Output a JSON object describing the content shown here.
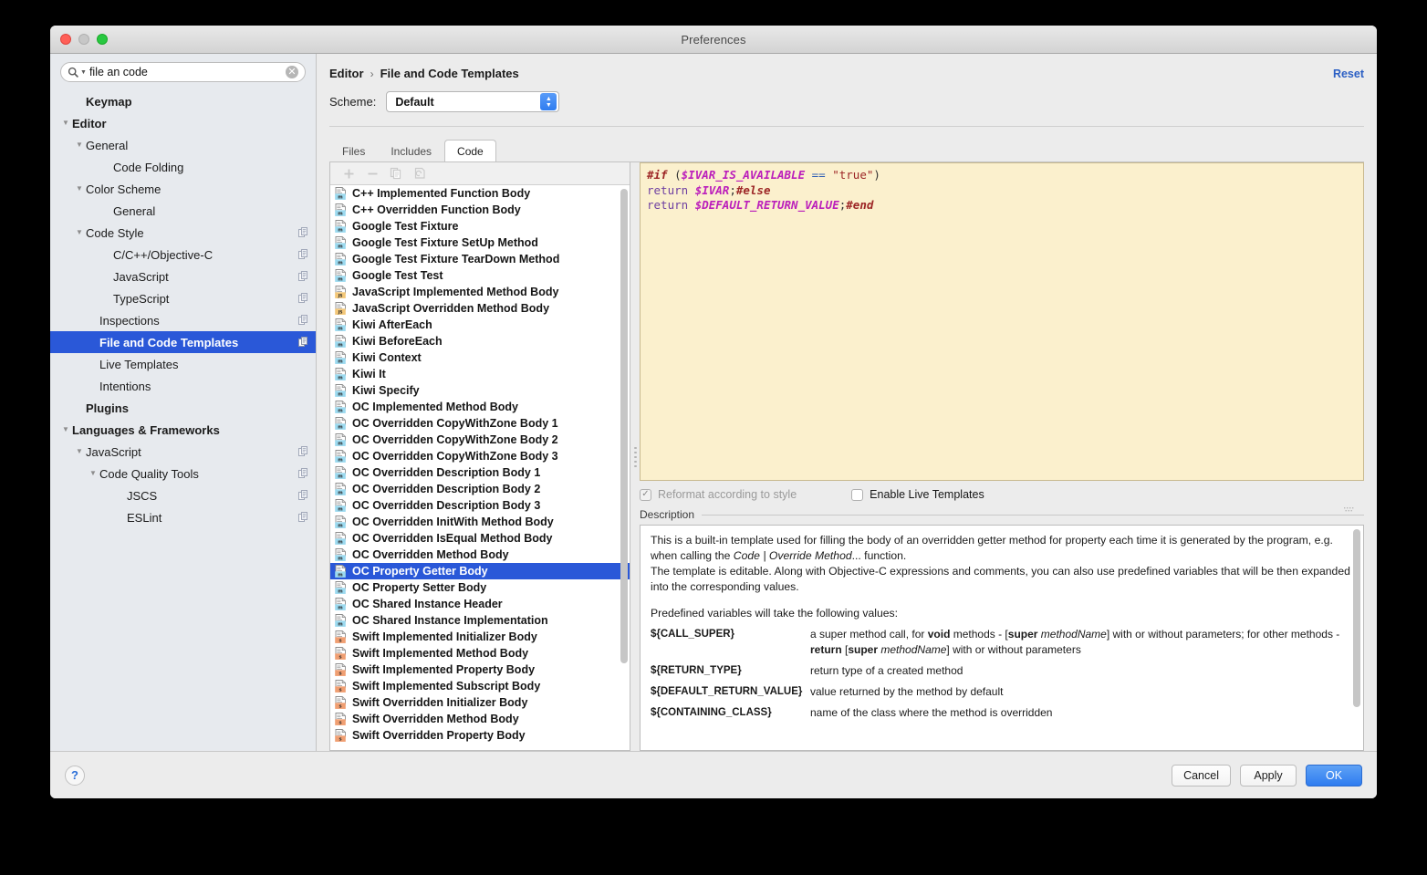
{
  "window": {
    "title": "Preferences"
  },
  "search": {
    "value": "file an code",
    "placeholder": "",
    "clear_glyph": "✕"
  },
  "sidebar": {
    "items": [
      {
        "label": "Keymap",
        "indent": 1,
        "bold": true,
        "twisty": "",
        "badge": false,
        "selected": false
      },
      {
        "label": "Editor",
        "indent": 0,
        "bold": true,
        "twisty": "▼",
        "badge": false,
        "selected": false
      },
      {
        "label": "General",
        "indent": 1,
        "bold": false,
        "twisty": "▼",
        "badge": false,
        "selected": false
      },
      {
        "label": "Code Folding",
        "indent": 3,
        "bold": false,
        "twisty": "",
        "badge": false,
        "selected": false
      },
      {
        "label": "Color Scheme",
        "indent": 1,
        "bold": false,
        "twisty": "▼",
        "badge": false,
        "selected": false
      },
      {
        "label": "General",
        "indent": 3,
        "bold": false,
        "twisty": "",
        "badge": false,
        "selected": false
      },
      {
        "label": "Code Style",
        "indent": 1,
        "bold": false,
        "twisty": "▼",
        "badge": true,
        "selected": false
      },
      {
        "label": "C/C++/Objective-C",
        "indent": 3,
        "bold": false,
        "twisty": "",
        "badge": true,
        "selected": false
      },
      {
        "label": "JavaScript",
        "indent": 3,
        "bold": false,
        "twisty": "",
        "badge": true,
        "selected": false
      },
      {
        "label": "TypeScript",
        "indent": 3,
        "bold": false,
        "twisty": "",
        "badge": true,
        "selected": false
      },
      {
        "label": "Inspections",
        "indent": 2,
        "bold": false,
        "twisty": "",
        "badge": true,
        "selected": false
      },
      {
        "label": "File and Code Templates",
        "indent": 2,
        "bold": true,
        "twisty": "",
        "badge": true,
        "selected": true
      },
      {
        "label": "Live Templates",
        "indent": 2,
        "bold": false,
        "twisty": "",
        "badge": false,
        "selected": false
      },
      {
        "label": "Intentions",
        "indent": 2,
        "bold": false,
        "twisty": "",
        "badge": false,
        "selected": false
      },
      {
        "label": "Plugins",
        "indent": 1,
        "bold": true,
        "twisty": "",
        "badge": false,
        "selected": false
      },
      {
        "label": "Languages & Frameworks",
        "indent": 0,
        "bold": true,
        "twisty": "▼",
        "badge": false,
        "selected": false
      },
      {
        "label": "JavaScript",
        "indent": 1,
        "bold": false,
        "twisty": "▼",
        "badge": true,
        "selected": false
      },
      {
        "label": "Code Quality Tools",
        "indent": 2,
        "bold": false,
        "twisty": "▼",
        "badge": true,
        "selected": false
      },
      {
        "label": "JSCS",
        "indent": 4,
        "bold": false,
        "twisty": "",
        "badge": true,
        "selected": false
      },
      {
        "label": "ESLint",
        "indent": 4,
        "bold": false,
        "twisty": "",
        "badge": true,
        "selected": false
      }
    ]
  },
  "header": {
    "breadcrumb": [
      "Editor",
      "File and Code Templates"
    ],
    "breadcrumb_separator": "›",
    "reset_label": "Reset",
    "scheme_label": "Scheme:",
    "scheme_value": "Default",
    "scheme_options": [
      "Default"
    ]
  },
  "tabs": [
    {
      "label": "Files",
      "active": false
    },
    {
      "label": "Includes",
      "active": false
    },
    {
      "label": "Code",
      "active": true
    }
  ],
  "list_toolbar": [
    {
      "name": "add-template-button",
      "glyph": "+"
    },
    {
      "name": "remove-template-button",
      "glyph": "−"
    },
    {
      "name": "copy-template-button",
      "glyph": "copy"
    },
    {
      "name": "reset-template-button",
      "glyph": "revert"
    }
  ],
  "templates": [
    {
      "label": "C++ Implemented Function Body",
      "kind": "m",
      "selected": false
    },
    {
      "label": "C++ Overridden Function Body",
      "kind": "m",
      "selected": false
    },
    {
      "label": "Google Test Fixture",
      "kind": "m",
      "selected": false
    },
    {
      "label": "Google Test Fixture SetUp Method",
      "kind": "m",
      "selected": false
    },
    {
      "label": "Google Test Fixture TearDown Method",
      "kind": "m",
      "selected": false
    },
    {
      "label": "Google Test Test",
      "kind": "m",
      "selected": false
    },
    {
      "label": "JavaScript Implemented Method Body",
      "kind": "js",
      "selected": false
    },
    {
      "label": "JavaScript Overridden Method Body",
      "kind": "js",
      "selected": false
    },
    {
      "label": "Kiwi AfterEach",
      "kind": "m",
      "selected": false
    },
    {
      "label": "Kiwi BeforeEach",
      "kind": "m",
      "selected": false
    },
    {
      "label": "Kiwi Context",
      "kind": "m",
      "selected": false
    },
    {
      "label": "Kiwi It",
      "kind": "m",
      "selected": false
    },
    {
      "label": "Kiwi Specify",
      "kind": "m",
      "selected": false
    },
    {
      "label": "OC Implemented Method Body",
      "kind": "m",
      "selected": false
    },
    {
      "label": "OC Overridden CopyWithZone Body 1",
      "kind": "m",
      "selected": false
    },
    {
      "label": "OC Overridden CopyWithZone Body 2",
      "kind": "m",
      "selected": false
    },
    {
      "label": "OC Overridden CopyWithZone Body 3",
      "kind": "m",
      "selected": false
    },
    {
      "label": "OC Overridden Description Body 1",
      "kind": "m",
      "selected": false
    },
    {
      "label": "OC Overridden Description Body 2",
      "kind": "m",
      "selected": false
    },
    {
      "label": "OC Overridden Description Body 3",
      "kind": "m",
      "selected": false
    },
    {
      "label": "OC Overridden InitWith Method Body",
      "kind": "m",
      "selected": false
    },
    {
      "label": "OC Overridden IsEqual Method Body",
      "kind": "m",
      "selected": false
    },
    {
      "label": "OC Overridden Method Body",
      "kind": "m",
      "selected": false
    },
    {
      "label": "OC Property Getter Body",
      "kind": "m",
      "selected": true
    },
    {
      "label": "OC Property Setter Body",
      "kind": "m",
      "selected": false
    },
    {
      "label": "OC Shared Instance Header",
      "kind": "m",
      "selected": false
    },
    {
      "label": "OC Shared Instance Implementation",
      "kind": "m",
      "selected": false
    },
    {
      "label": "Swift Implemented Initializer Body",
      "kind": "s",
      "selected": false
    },
    {
      "label": "Swift Implemented Method Body",
      "kind": "s",
      "selected": false
    },
    {
      "label": "Swift Implemented Property Body",
      "kind": "s",
      "selected": false
    },
    {
      "label": "Swift Implemented Subscript Body",
      "kind": "s",
      "selected": false
    },
    {
      "label": "Swift Overridden Initializer Body",
      "kind": "s",
      "selected": false
    },
    {
      "label": "Swift Overridden Method Body",
      "kind": "s",
      "selected": false
    },
    {
      "label": "Swift Overridden Property Body",
      "kind": "s",
      "selected": false
    }
  ],
  "editor": {
    "lines": [
      [
        {
          "t": "#if ",
          "c": "dir"
        },
        {
          "t": "(",
          "c": "plain"
        },
        {
          "t": "$IVAR_IS_AVAILABLE",
          "c": "var"
        },
        {
          "t": " ",
          "c": "plain"
        },
        {
          "t": "==",
          "c": "op"
        },
        {
          "t": " ",
          "c": "plain"
        },
        {
          "t": "\"true\"",
          "c": "str"
        },
        {
          "t": ")",
          "c": "plain"
        }
      ],
      [
        {
          "t": "return ",
          "c": "kw"
        },
        {
          "t": "$IVAR",
          "c": "var"
        },
        {
          "t": ";",
          "c": "plain"
        },
        {
          "t": "#else",
          "c": "dir"
        }
      ],
      [
        {
          "t": "return ",
          "c": "kw"
        },
        {
          "t": "$DEFAULT_RETURN_VALUE",
          "c": "var"
        },
        {
          "t": ";",
          "c": "plain"
        },
        {
          "t": "#end",
          "c": "dir"
        }
      ]
    ],
    "background_color": "#fbf0cd"
  },
  "options": {
    "reformat": {
      "label": "Reformat according to style",
      "checked": true,
      "enabled": false,
      "check_glyph": "✓"
    },
    "live_templates": {
      "label": "Enable Live Templates",
      "checked": false,
      "enabled": true,
      "check_glyph": "✓"
    }
  },
  "description": {
    "legend": "Description",
    "paragraphs": [
      "This is a built-in template used for filling the body of an overridden getter method for property each time it is generated by the program, e.g. when calling the Code | Override Method... function.",
      "The template is editable. Along with Objective-C expressions and comments, you can also use predefined variables that will be then expanded into the corresponding values.",
      "Predefined variables will take the following values:"
    ],
    "variables": [
      {
        "name": "${CALL_SUPER}",
        "desc": "a super method call, for void methods - [super methodName] with or without parameters; for other methods - return [super methodName] with or without parameters"
      },
      {
        "name": "${RETURN_TYPE}",
        "desc": "return type of a created method"
      },
      {
        "name": "${DEFAULT_RETURN_VALUE}",
        "desc": "value returned by the method by default"
      },
      {
        "name": "${CONTAINING_CLASS}",
        "desc": "name of the class where the method is overridden"
      }
    ]
  },
  "footer": {
    "help_glyph": "?",
    "cancel_label": "Cancel",
    "apply_label": "Apply",
    "ok_label": "OK"
  },
  "colors": {
    "selection_blue": "#2a58d8",
    "primary_button": "#2e7cf0",
    "link_blue": "#2b5fc4",
    "editor_bg": "#fbf0cd"
  }
}
